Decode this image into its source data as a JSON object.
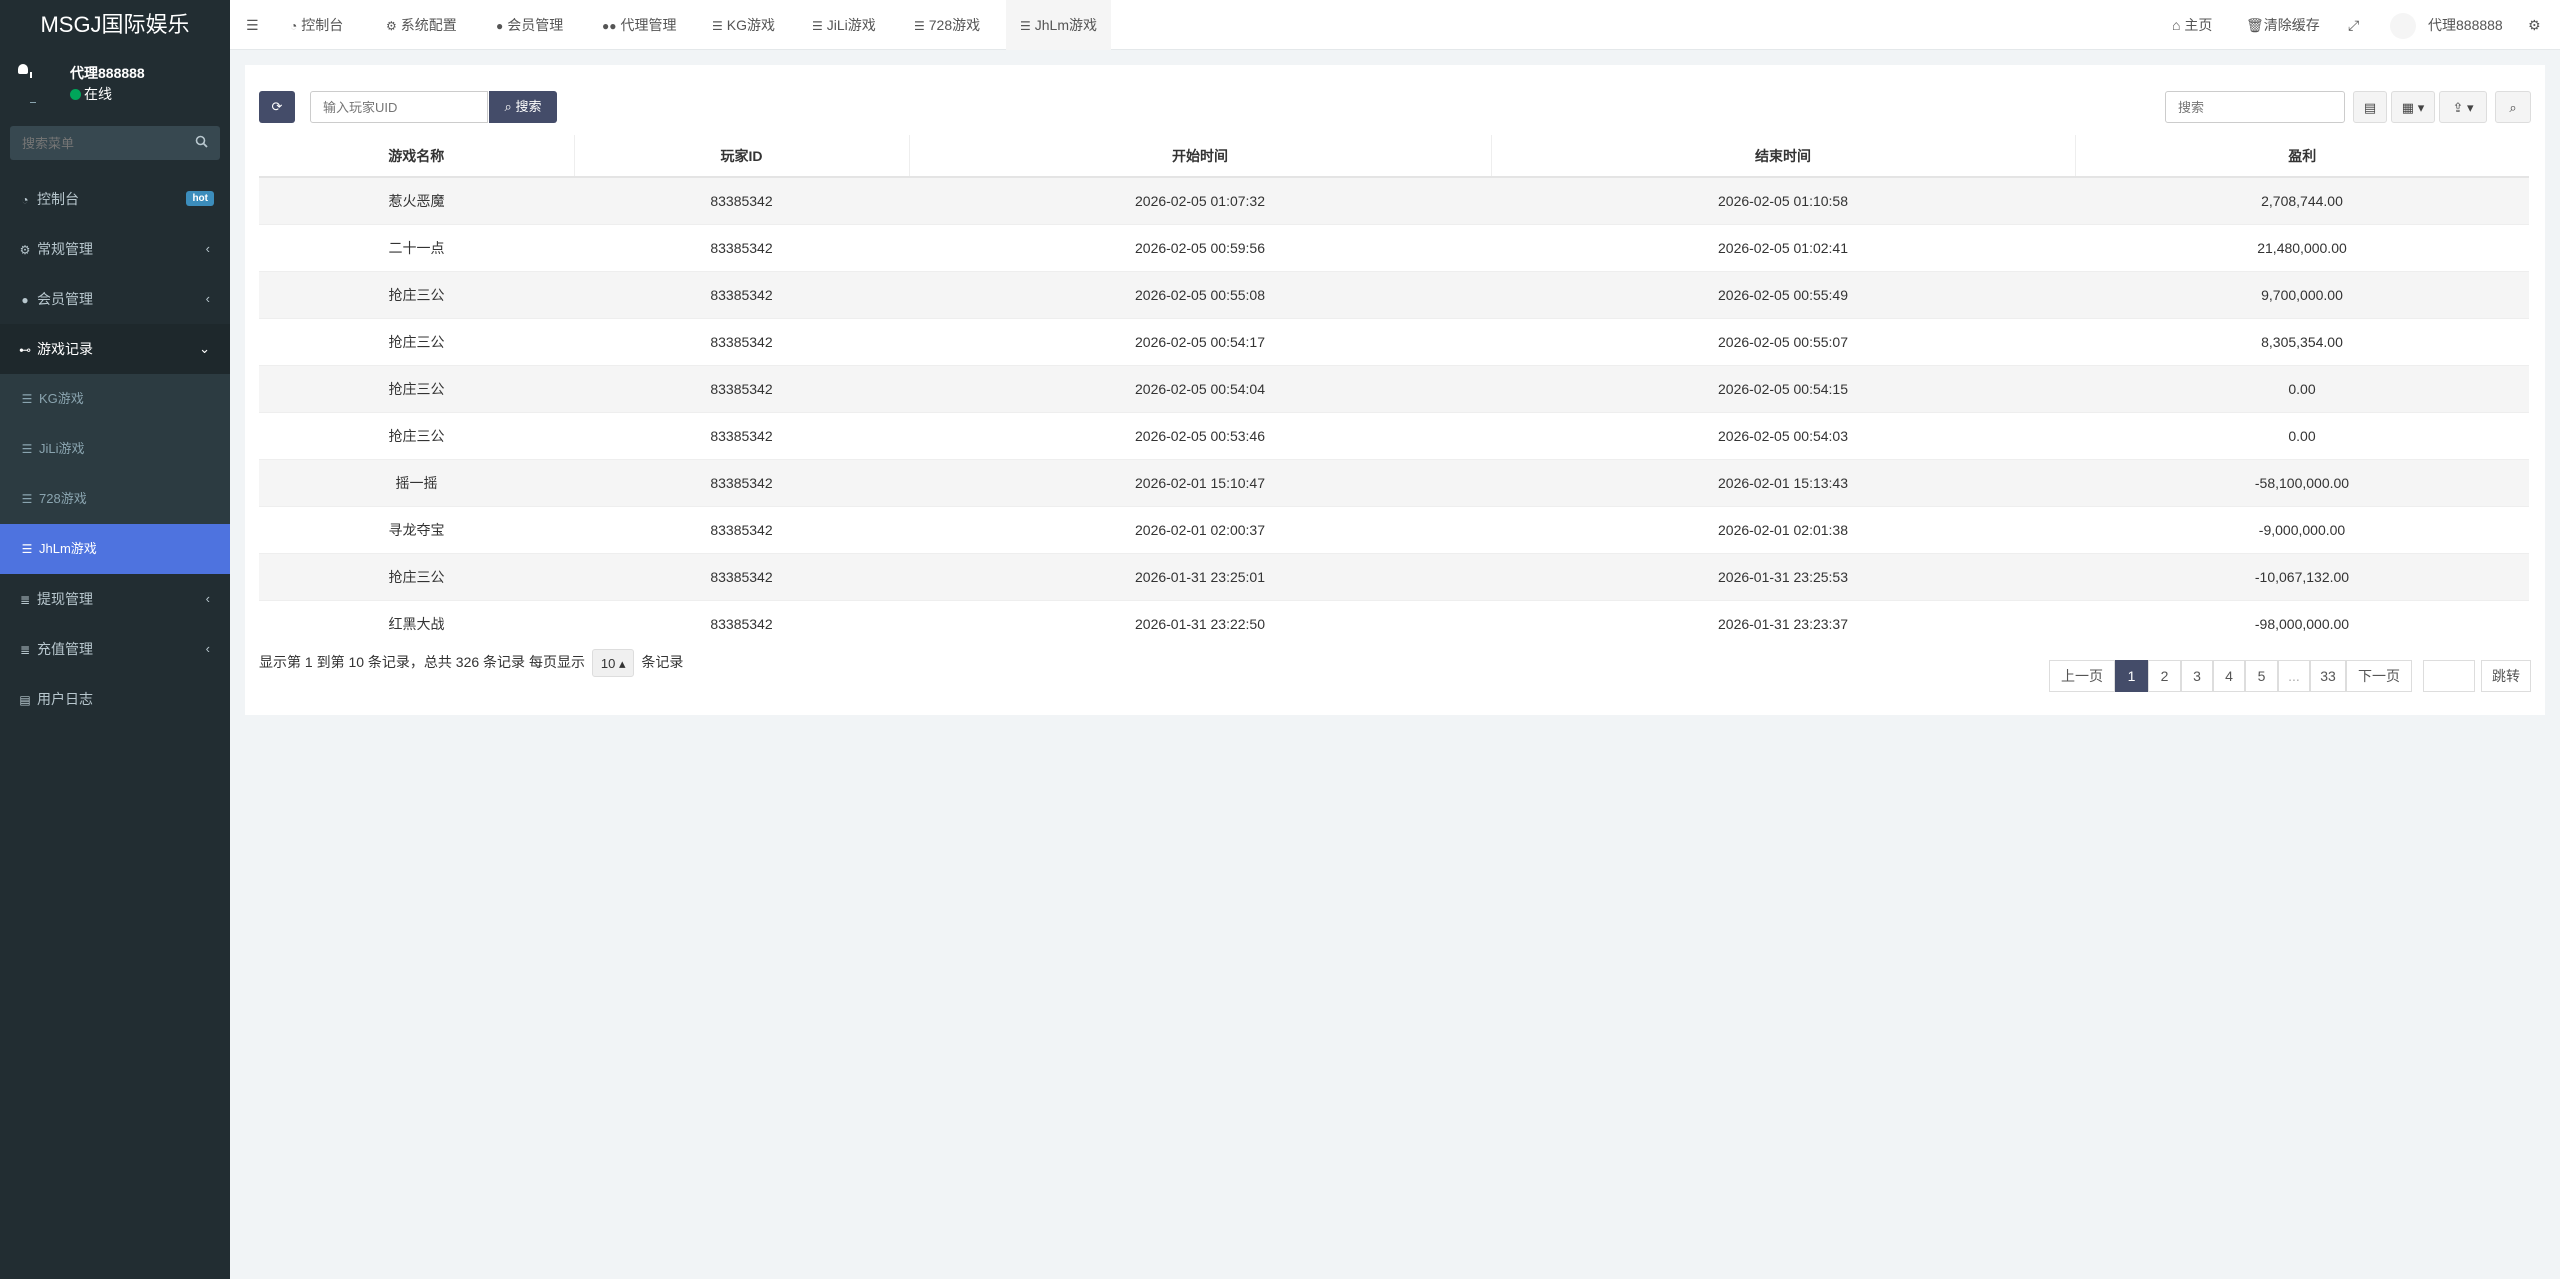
{
  "brand": "MSGJ国际娱乐",
  "user": {
    "name": "代理888888",
    "status": "在线"
  },
  "sidebar": {
    "search_placeholder": "搜索菜单",
    "items": [
      {
        "label": "控制台",
        "icon": "dashboard-icon",
        "badge": "hot"
      },
      {
        "label": "常规管理",
        "icon": "cogs-icon"
      },
      {
        "label": "会员管理",
        "icon": "user-circle-icon"
      },
      {
        "label": "游戏记录",
        "icon": "gamepad-icon"
      },
      {
        "label": "提现管理",
        "icon": "database-icon"
      },
      {
        "label": "充值管理",
        "icon": "database-icon"
      },
      {
        "label": "用户日志",
        "icon": "file-icon"
      }
    ],
    "sub_items": [
      {
        "label": "KG游戏"
      },
      {
        "label": "JiLi游戏"
      },
      {
        "label": "728游戏"
      },
      {
        "label": "JhLm游戏"
      }
    ]
  },
  "topbar": {
    "tabs": [
      {
        "label": "控制台",
        "icon": "dashboard-icon"
      },
      {
        "label": "系统配置",
        "icon": "gear-icon"
      },
      {
        "label": "会员管理",
        "icon": "user-icon"
      },
      {
        "label": "代理管理",
        "icon": "users-icon"
      },
      {
        "label": "KG游戏",
        "icon": "list-icon"
      },
      {
        "label": "JiLi游戏",
        "icon": "list-icon"
      },
      {
        "label": "728游戏",
        "icon": "list-icon"
      },
      {
        "label": "JhLm游戏",
        "icon": "list-icon"
      }
    ],
    "home": "主页",
    "clear_cache": "清除缓存",
    "user_name": "代理888888"
  },
  "toolbar": {
    "uid_placeholder": "输入玩家UID",
    "search_label": "搜索",
    "search_placeholder": "搜索"
  },
  "table": {
    "headers": [
      "游戏名称",
      "玩家ID",
      "开始时间",
      "结束时间",
      "盈利"
    ],
    "rows": [
      [
        "惹火恶魔",
        "83385342",
        "2026-02-05 01:07:32",
        "2026-02-05 01:10:58",
        "2,708,744.00"
      ],
      [
        "二十一点",
        "83385342",
        "2026-02-05 00:59:56",
        "2026-02-05 01:02:41",
        "21,480,000.00"
      ],
      [
        "抢庄三公",
        "83385342",
        "2026-02-05 00:55:08",
        "2026-02-05 00:55:49",
        "9,700,000.00"
      ],
      [
        "抢庄三公",
        "83385342",
        "2026-02-05 00:54:17",
        "2026-02-05 00:55:07",
        "8,305,354.00"
      ],
      [
        "抢庄三公",
        "83385342",
        "2026-02-05 00:54:04",
        "2026-02-05 00:54:15",
        "0.00"
      ],
      [
        "抢庄三公",
        "83385342",
        "2026-02-05 00:53:46",
        "2026-02-05 00:54:03",
        "0.00"
      ],
      [
        "摇一摇",
        "83385342",
        "2026-02-01 15:10:47",
        "2026-02-01 15:13:43",
        "-58,100,000.00"
      ],
      [
        "寻龙夺宝",
        "83385342",
        "2026-02-01 02:00:37",
        "2026-02-01 02:01:38",
        "-9,000,000.00"
      ],
      [
        "抢庄三公",
        "83385342",
        "2026-01-31 23:25:01",
        "2026-01-31 23:25:53",
        "-10,067,132.00"
      ],
      [
        "红黑大战",
        "83385342",
        "2026-01-31 23:22:50",
        "2026-01-31 23:23:37",
        "-98,000,000.00"
      ]
    ]
  },
  "footer": {
    "info_prefix": "显示第 1 到第 10 条记录，总共 326 条记录 每页显示",
    "page_size": "10",
    "info_suffix": "条记录"
  },
  "pagination": {
    "prev": "上一页",
    "pages": [
      "1",
      "2",
      "3",
      "4",
      "5",
      "...",
      "33"
    ],
    "next": "下一页",
    "jump": "跳转",
    "current": "1"
  }
}
